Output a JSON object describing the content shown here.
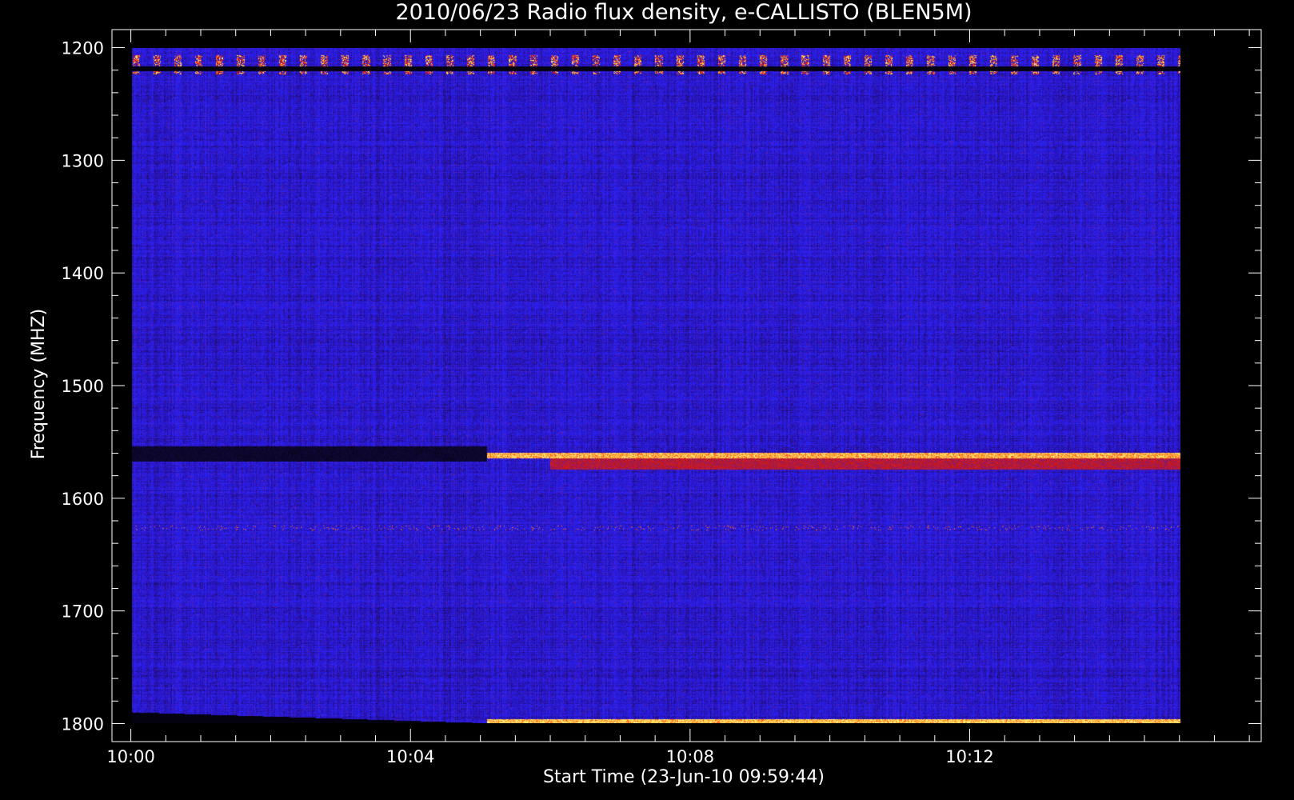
{
  "chart_data": {
    "type": "heatmap",
    "title": "2010/06/23  Radio flux density, e-CALLISTO (BLEN5M)",
    "xlabel": "Start Time (23-Jun-10 09:59:44)",
    "ylabel": "Frequency (MHZ)",
    "x_ticks": [
      "10:00",
      "10:04",
      "10:08",
      "10:12"
    ],
    "x_tick_minutes": [
      0,
      4,
      8,
      12
    ],
    "xlim_minutes": [
      -0.27,
      16.17
    ],
    "data_x_minutes": [
      0.02,
      15.02
    ],
    "y_ticks": [
      1200,
      1300,
      1400,
      1500,
      1600,
      1700,
      1800
    ],
    "ylim": [
      1184,
      1816
    ],
    "y_reversed": true,
    "data_y_range": [
      1200,
      1800
    ],
    "colormap": [
      "#000000",
      "#1a0d5c",
      "#2c12b4",
      "#2424ff",
      "#6a1aa8",
      "#c01818",
      "#ff2010",
      "#ffd040",
      "#ffffb0"
    ],
    "features": [
      {
        "label": "intermittent bright band",
        "freq_mhz": [
          1206,
          1223
        ],
        "t_minutes": [
          0.02,
          15.02
        ]
      },
      {
        "label": "bright narrow band",
        "freq_mhz": 1562,
        "t_minutes": [
          5.1,
          15.02
        ]
      },
      {
        "label": "bright narrow band",
        "freq_mhz": 1800,
        "t_minutes": [
          5.1,
          15.02
        ]
      }
    ]
  }
}
